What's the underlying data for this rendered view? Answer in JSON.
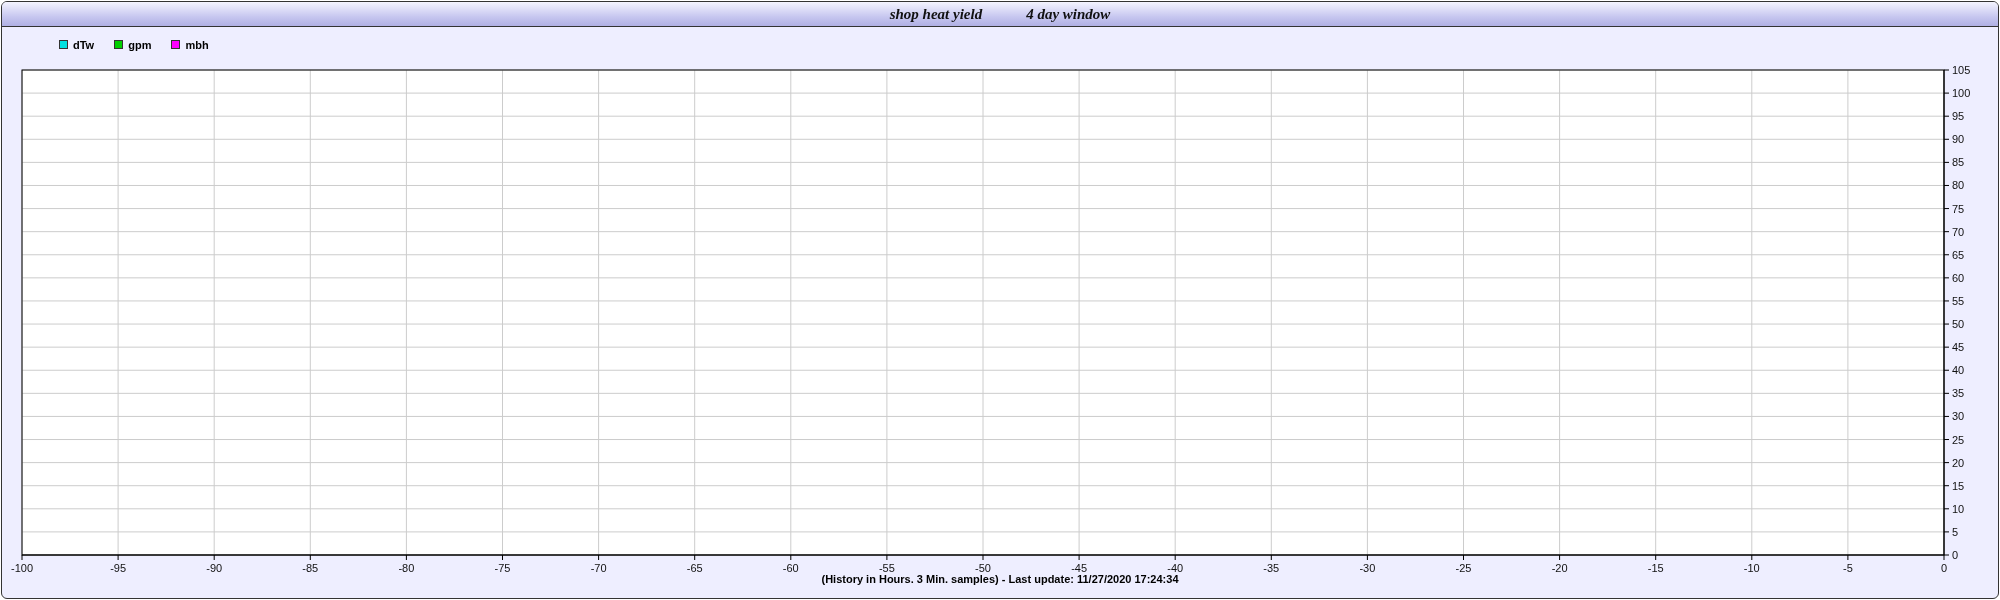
{
  "panel": {
    "title": "shop heat yield",
    "subtitle": "4 day window"
  },
  "chart": {
    "chart_data": {
      "type": "line",
      "series": [
        {
          "name": "dTw",
          "color": "#00e0e0",
          "values": [
            null,
            null,
            null,
            null,
            null,
            null,
            null,
            null,
            null,
            null,
            null,
            null,
            null,
            null,
            null,
            null,
            null,
            null,
            null,
            null,
            null
          ]
        },
        {
          "name": "gpm",
          "color": "#00d000",
          "values": [
            null,
            null,
            null,
            null,
            null,
            null,
            null,
            null,
            null,
            null,
            null,
            null,
            null,
            null,
            null,
            null,
            null,
            null,
            null,
            null,
            null
          ]
        },
        {
          "name": "mbh",
          "color": "#ff00ff",
          "values": [
            null,
            null,
            null,
            null,
            null,
            null,
            null,
            null,
            null,
            null,
            null,
            null,
            null,
            null,
            null,
            null,
            null,
            null,
            null,
            null,
            null
          ]
        }
      ],
      "categories": [
        "-100",
        "-95",
        "-90",
        "-85",
        "-80",
        "-75",
        "-70",
        "-65",
        "-60",
        "-55",
        "-50",
        "-45",
        "-40",
        "-35",
        "-30",
        "-25",
        "-20",
        "-15",
        "-10",
        "-5",
        "0"
      ],
      "ylim": [
        0,
        105
      ],
      "grid": true,
      "yticks": [
        0,
        5,
        10,
        15,
        20,
        25,
        30,
        35,
        40,
        45,
        50,
        55,
        60,
        65,
        70,
        75,
        80,
        85,
        90,
        95,
        100,
        105
      ]
    },
    "footer": "(History in Hours. 3 Min. samples) - Last update: 11/27/2020 17:24:34"
  }
}
